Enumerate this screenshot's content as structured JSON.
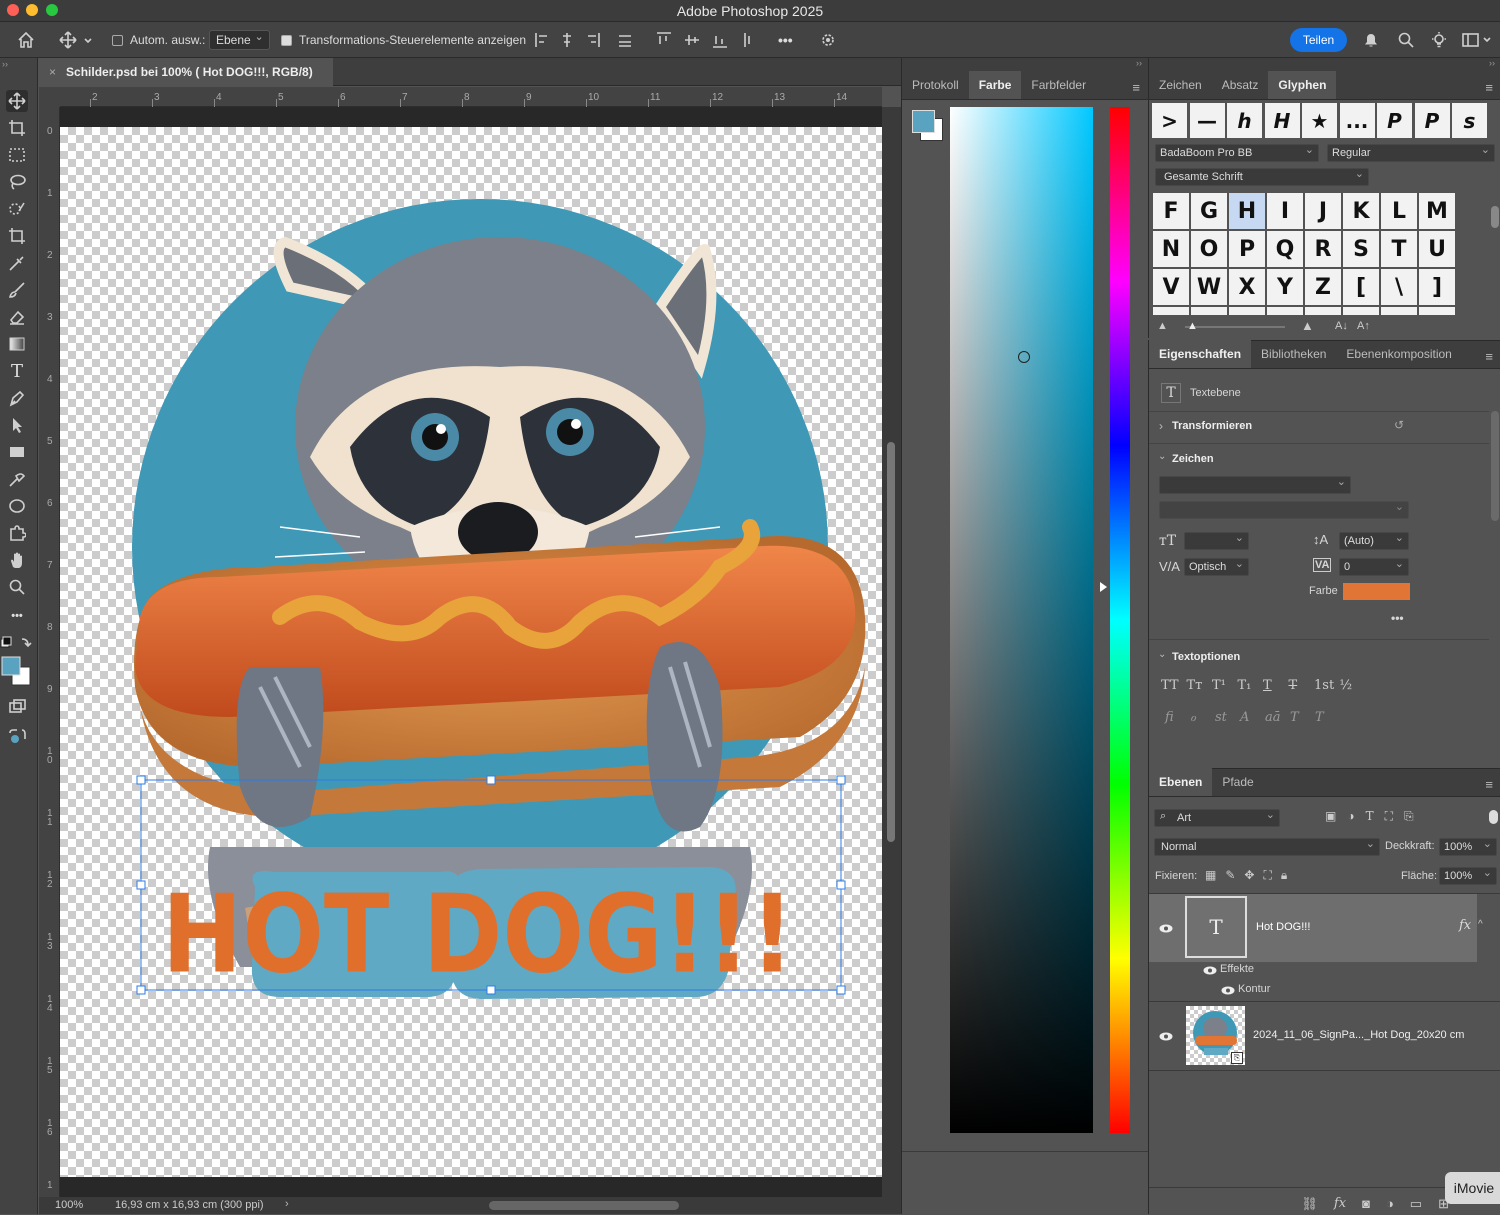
{
  "app": {
    "title": "Adobe Photoshop 2025"
  },
  "options_bar": {
    "auto_select_label": "Autom. ausw.:",
    "auto_select_value": "Ebene",
    "transform_controls_label": "Transformations-Steuerelemente anzeigen",
    "more_label": "•••",
    "share_label": "Teilen"
  },
  "document": {
    "tab_title": "Schilder.psd bei 100% ( Hot DOG!!!, RGB/8)",
    "zoom": "100%",
    "doc_size": "16,93 cm x 16,93 cm (300 ppi)",
    "ruler_h": [
      "2",
      "3",
      "4",
      "5",
      "6",
      "7",
      "8",
      "9",
      "10",
      "11",
      "12",
      "13",
      "14"
    ],
    "ruler_v": [
      "0",
      "1",
      "2",
      "3",
      "4",
      "5",
      "6",
      "7",
      "8",
      "9",
      "1 0",
      "1 1",
      "1 2",
      "1 3",
      "1 4",
      "1 5",
      "1 6",
      "1"
    ],
    "artwork_text": "HOT DOG!!!"
  },
  "color_panel": {
    "tabs": [
      "Protokoll",
      "Farbe",
      "Farbfelder"
    ],
    "foreground": "#5aa3c0"
  },
  "glyph_panel": {
    "tabs": [
      "Zeichen",
      "Absatz",
      "Glyphen"
    ],
    "recent": [
      ">",
      "—",
      "h",
      "H",
      "★",
      "...",
      "P",
      "P",
      "s"
    ],
    "font": "BadaBoom Pro BB",
    "style": "Regular",
    "filter": "Gesamte Schrift",
    "grid": [
      [
        "F",
        "G",
        "H",
        "I",
        "J",
        "K",
        "L",
        "M"
      ],
      [
        "N",
        "O",
        "P",
        "Q",
        "R",
        "S",
        "T",
        "U"
      ],
      [
        "V",
        "W",
        "X",
        "Y",
        "Z",
        "[",
        "\\",
        "]"
      ]
    ]
  },
  "properties_panel": {
    "tabs": [
      "Eigenschaften",
      "Bibliotheken",
      "Ebenenkomposition"
    ],
    "layer_type": "Textebene",
    "transform_label": "Transformieren",
    "character_label": "Zeichen",
    "leading_value": "(Auto)",
    "kerning_value": "Optisch",
    "tracking_value": "0",
    "color_label": "Farbe",
    "color_value": "#e07535",
    "text_options_label": "Textoptionen",
    "type_buttons": [
      "TT",
      "Tт",
      "T¹",
      "T₁",
      "T",
      "T",
      "1st",
      "½"
    ],
    "opentype_buttons": [
      "fi",
      "ℴ",
      "st",
      "A",
      "aā",
      "T",
      "T"
    ]
  },
  "layers_panel": {
    "tabs": [
      "Ebenen",
      "Pfade"
    ],
    "filter_label": "Art",
    "blend_mode": "Normal",
    "opacity_label": "Deckkraft:",
    "opacity_value": "100%",
    "lock_label": "Fixieren:",
    "fill_label": "Fläche:",
    "fill_value": "100%",
    "layers": [
      {
        "name": "Hot DOG!!!",
        "thumb": "T",
        "effects_label": "Effekte",
        "effect": "Kontur"
      },
      {
        "name": "2024_11_06_SignPa..._Hot Dog_20x20 cm"
      }
    ]
  },
  "dock": {
    "imovie_label": "iMovie"
  }
}
